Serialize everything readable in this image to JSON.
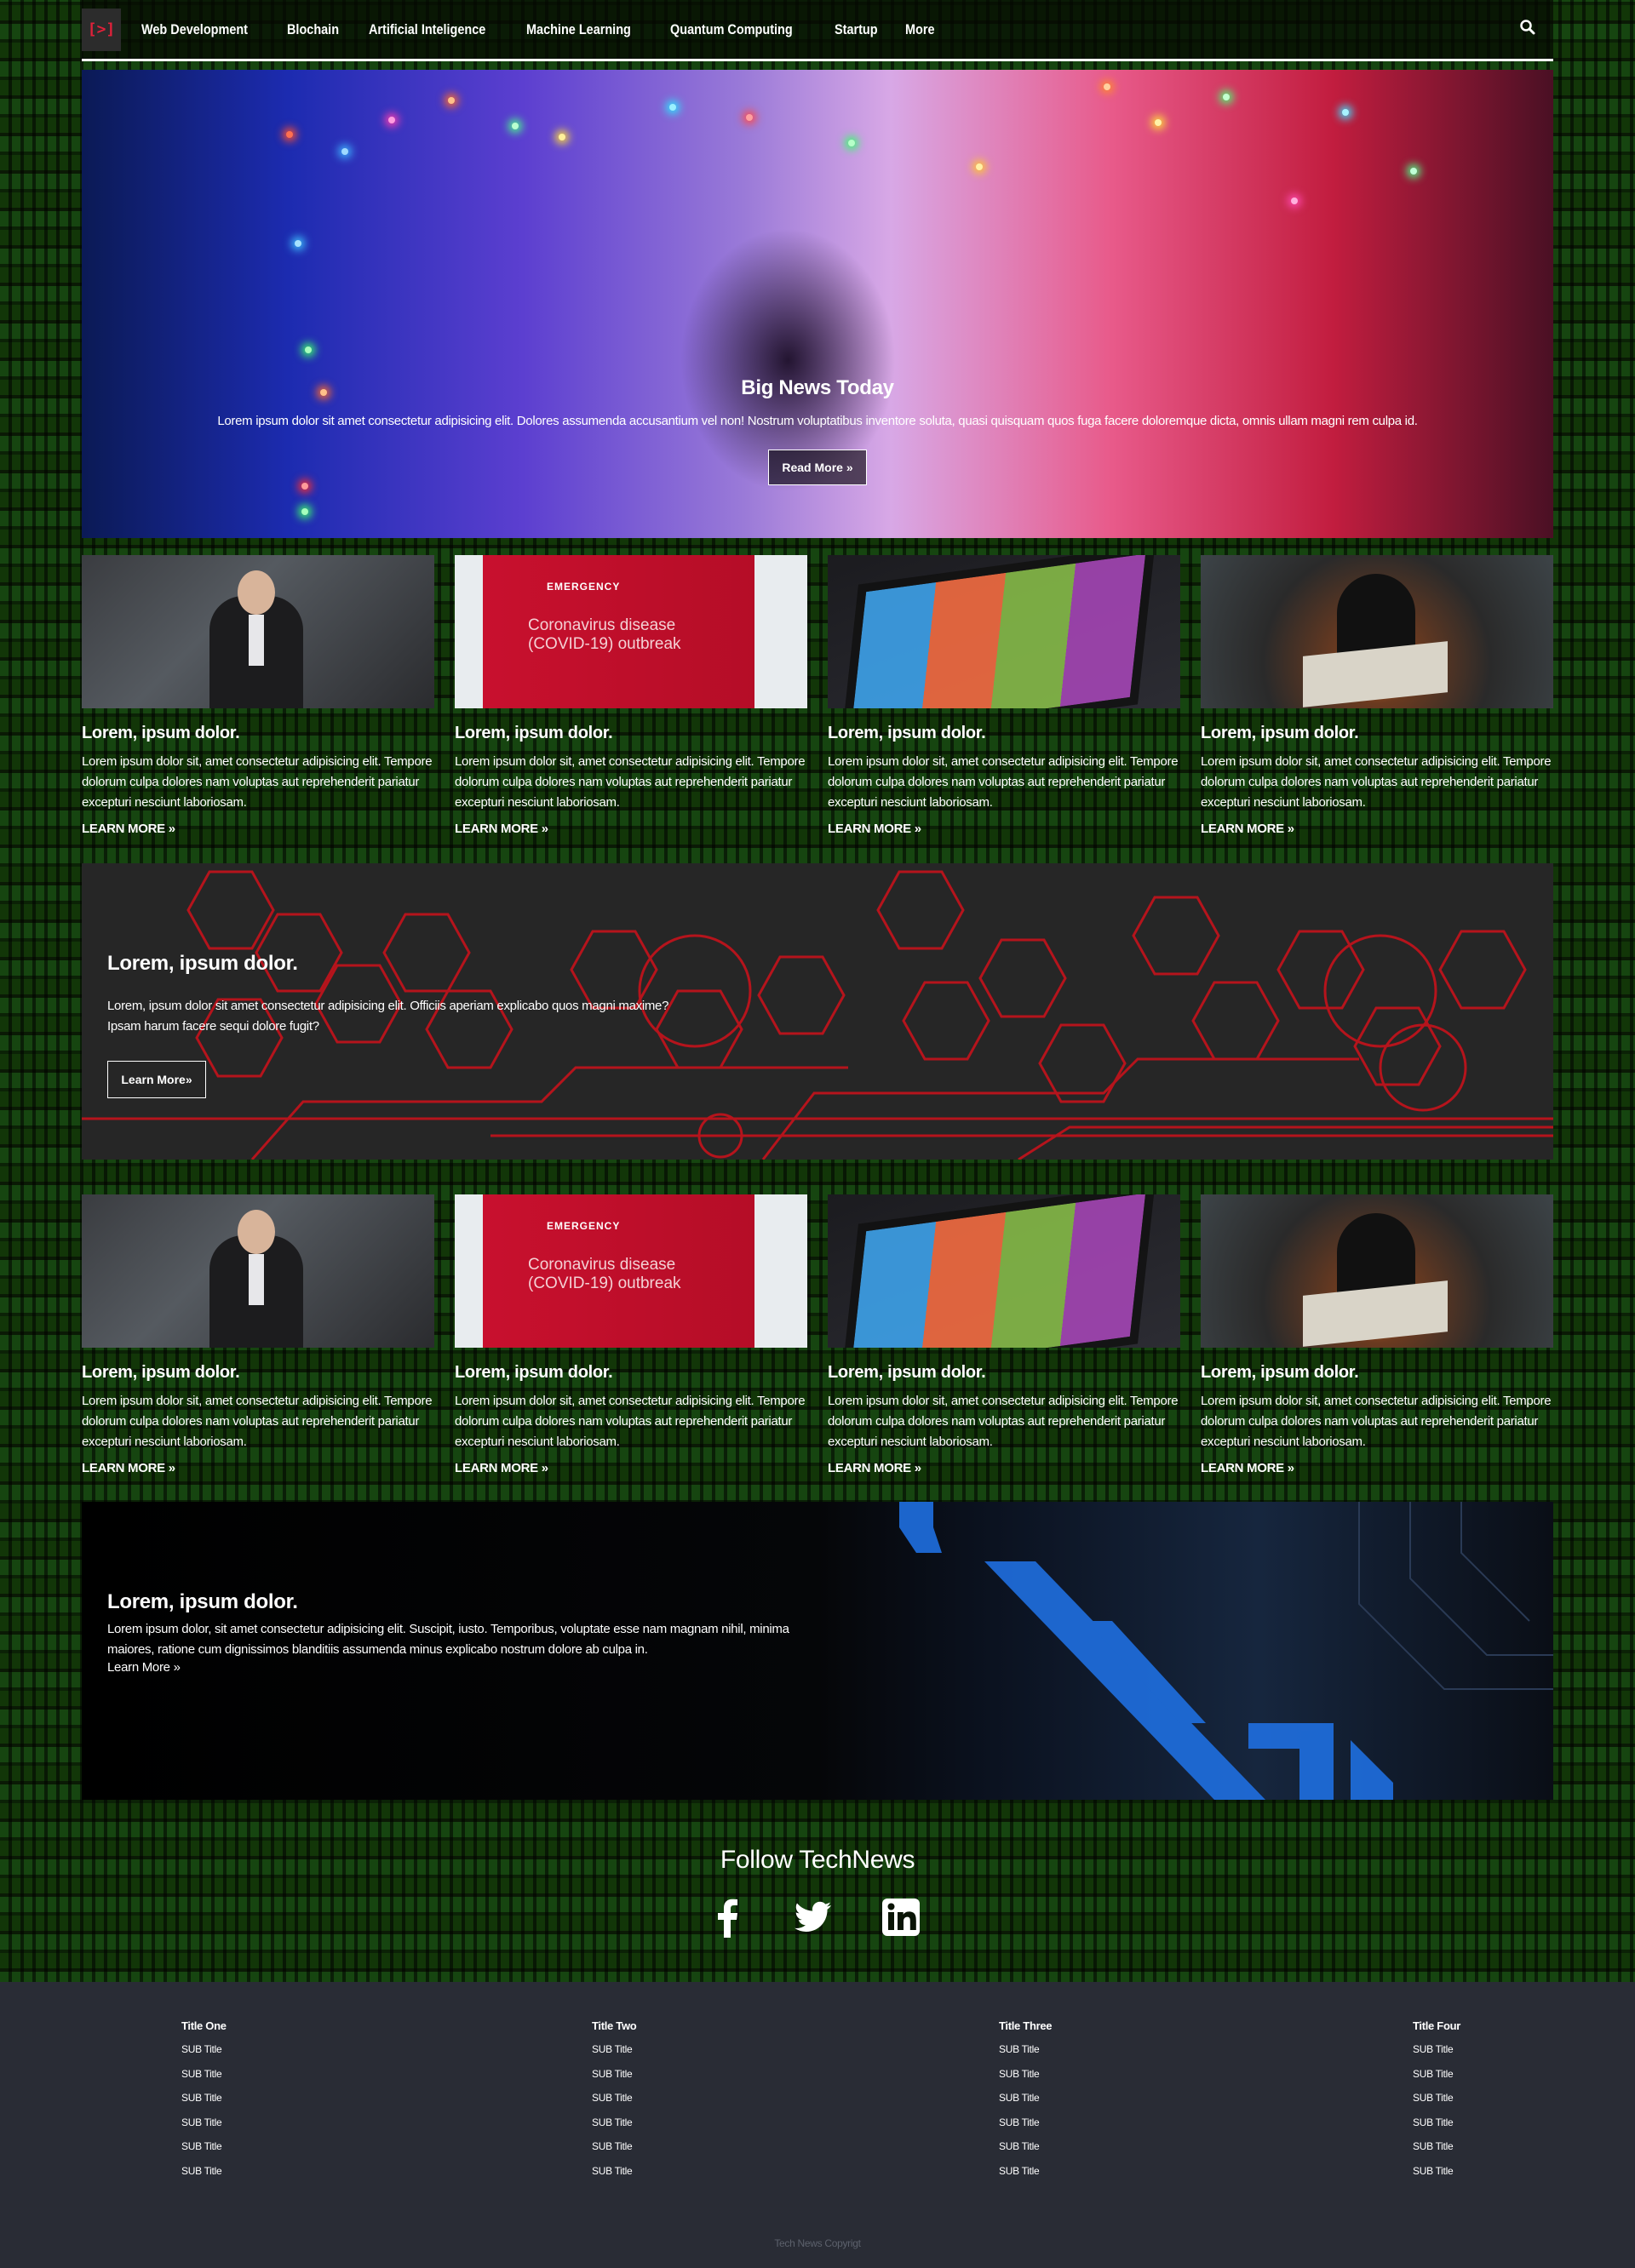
{
  "nav": {
    "logo": "[>]",
    "items": [
      "Web Development",
      "Blochain",
      "Artificial Inteligence",
      "Machine Learning",
      "Quantum Computing",
      "Startup",
      "More"
    ],
    "search_icon": "search-icon"
  },
  "hero": {
    "title": "Big News Today",
    "text": "Lorem ipsum dolor sit amet consectetur adipisicing elit. Dolores assumenda accusantium vel non! Nostrum voluptatibus inventore soluta, quasi quisquam quos fuga facere doloremque dicta, omnis ullam magni rem culpa id.",
    "button": "Read More »"
  },
  "cards_row1": [
    {
      "title": "Lorem, ipsum dolor.",
      "text": "Lorem ipsum dolor sit, amet consectetur adipisicing elit. Tempore dolorum culpa dolores nam voluptas aut reprehenderit pariatur excepturi nesciunt laboriosam.",
      "link": "LEARN MORE »",
      "image": "office-photo"
    },
    {
      "title": "Lorem, ipsum dolor.",
      "text": "Lorem ipsum dolor sit, amet consectetur adipisicing elit. Tempore dolorum culpa dolores nam voluptas aut reprehenderit pariatur excepturi nesciunt laboriosam.",
      "link": "LEARN MORE »",
      "image": "covid-sign-photo"
    },
    {
      "title": "Lorem, ipsum dolor.",
      "text": "Lorem ipsum dolor sit, amet consectetur adipisicing elit. Tempore dolorum culpa dolores nam voluptas aut reprehenderit pariatur excepturi nesciunt laboriosam.",
      "link": "LEARN MORE »",
      "image": "tablet-photo"
    },
    {
      "title": "Lorem, ipsum dolor.",
      "text": "Lorem ipsum dolor sit, amet consectetur adipisicing elit. Tempore dolorum culpa dolores nam voluptas aut reprehenderit pariatur excepturi nesciunt laboriosam.",
      "link": "LEARN MORE »",
      "image": "hooded-hacker-photo"
    }
  ],
  "covid_sign": {
    "label": "EMERGENCY",
    "text": "Coronavirus disease (COVID-19) outbreak"
  },
  "banner1": {
    "title": "Lorem, ipsum dolor.",
    "text": "Lorem, ipsum dolor sit amet consectetur adipisicing elit. Officiis aperiam explicabo quos magni maxime? Ipsam harum facere sequi dolore fugit?",
    "button": "Learn More»"
  },
  "cards_row2": [
    {
      "title": "Lorem, ipsum dolor.",
      "text": "Lorem ipsum dolor sit, amet consectetur adipisicing elit. Tempore dolorum culpa dolores nam voluptas aut reprehenderit pariatur excepturi nesciunt laboriosam.",
      "link": "LEARN MORE »",
      "image": "office-photo"
    },
    {
      "title": "Lorem, ipsum dolor.",
      "text": "Lorem ipsum dolor sit, amet consectetur adipisicing elit. Tempore dolorum culpa dolores nam voluptas aut reprehenderit pariatur excepturi nesciunt laboriosam.",
      "link": "LEARN MORE »",
      "image": "covid-sign-photo"
    },
    {
      "title": "Lorem, ipsum dolor.",
      "text": "Lorem ipsum dolor sit, amet consectetur adipisicing elit. Tempore dolorum culpa dolores nam voluptas aut reprehenderit pariatur excepturi nesciunt laboriosam.",
      "link": "LEARN MORE »",
      "image": "tablet-photo"
    },
    {
      "title": "Lorem, ipsum dolor.",
      "text": "Lorem ipsum dolor sit, amet consectetur adipisicing elit. Tempore dolorum culpa dolores nam voluptas aut reprehenderit pariatur excepturi nesciunt laboriosam.",
      "link": "LEARN MORE »",
      "image": "hooded-hacker-photo"
    }
  ],
  "banner2": {
    "title": "Lorem, ipsum dolor.",
    "text": "Lorem ipsum dolor, sit amet consectetur adipisicing elit. Suscipit, iusto. Temporibus, voluptate esse nam magnam nihil, minima maiores, ratione cum dignissimos blanditiis assumenda minus explicabo nostrum dolore ab culpa in.",
    "link": "Learn More »"
  },
  "follow": {
    "title": "Follow TechNews",
    "icons": [
      "facebook-icon",
      "twitter-icon",
      "linkedin-icon"
    ]
  },
  "footer": {
    "columns": [
      {
        "title": "Title One",
        "items": [
          "SUB Title",
          "SUB Title",
          "SUB Title",
          "SUB Title",
          "SUB Title",
          "SUB Title"
        ]
      },
      {
        "title": "Title Two",
        "items": [
          "SUB Title",
          "SUB Title",
          "SUB Title",
          "SUB Title",
          "SUB Title",
          "SUB Title"
        ]
      },
      {
        "title": "Title Three",
        "items": [
          "SUB Title",
          "SUB Title",
          "SUB Title",
          "SUB Title",
          "SUB Title",
          "SUB Title"
        ]
      },
      {
        "title": "Title Four",
        "items": [
          "SUB Title",
          "SUB Title",
          "SUB Title",
          "SUB Title",
          "SUB Title",
          "SUB Title"
        ]
      }
    ],
    "copyright": "Tech News Copyrigt"
  },
  "colors": {
    "accent_red": "#e0213a",
    "footer_bg": "#292c35",
    "hex_red": "#b5141c",
    "circuit_blue": "#1f6fe0"
  }
}
